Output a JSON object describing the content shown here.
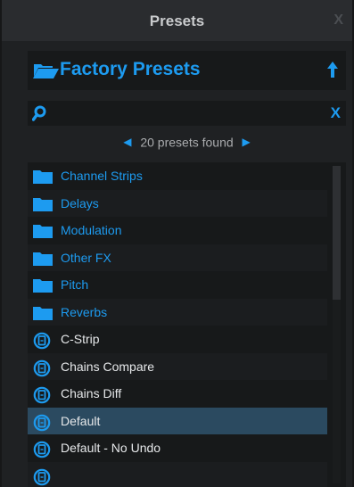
{
  "panel": {
    "title": "Presets",
    "close_label": "X"
  },
  "header": {
    "label": "Factory Presets",
    "folder_icon": "folder-open-icon",
    "up_icon": "arrow-up-icon"
  },
  "search": {
    "value": "",
    "placeholder": "",
    "clear_label": "X",
    "icon": "search-icon"
  },
  "nav": {
    "count_text": "20 presets found",
    "prev_icon": "triangle-left-icon",
    "next_icon": "triangle-right-icon"
  },
  "list": {
    "items": [
      {
        "label": "Channel Strips",
        "kind": "folder"
      },
      {
        "label": "Delays",
        "kind": "folder"
      },
      {
        "label": "Modulation",
        "kind": "folder"
      },
      {
        "label": "Other FX",
        "kind": "folder"
      },
      {
        "label": "Pitch",
        "kind": "folder"
      },
      {
        "label": "Reverbs",
        "kind": "folder"
      },
      {
        "label": "C-Strip",
        "kind": "preset"
      },
      {
        "label": "Chains Compare",
        "kind": "preset"
      },
      {
        "label": "Chains Diff",
        "kind": "preset"
      },
      {
        "label": "Default",
        "kind": "preset",
        "selected": true
      },
      {
        "label": "Default - No Undo",
        "kind": "preset"
      },
      {
        "label": "",
        "kind": "preset"
      }
    ]
  },
  "scroll": {
    "position_fraction": 0.0,
    "visible_fraction": 0.42
  },
  "colors": {
    "accent": "#1d9bf0",
    "selected_row": "#2b4a60",
    "background": "#1f2123"
  }
}
